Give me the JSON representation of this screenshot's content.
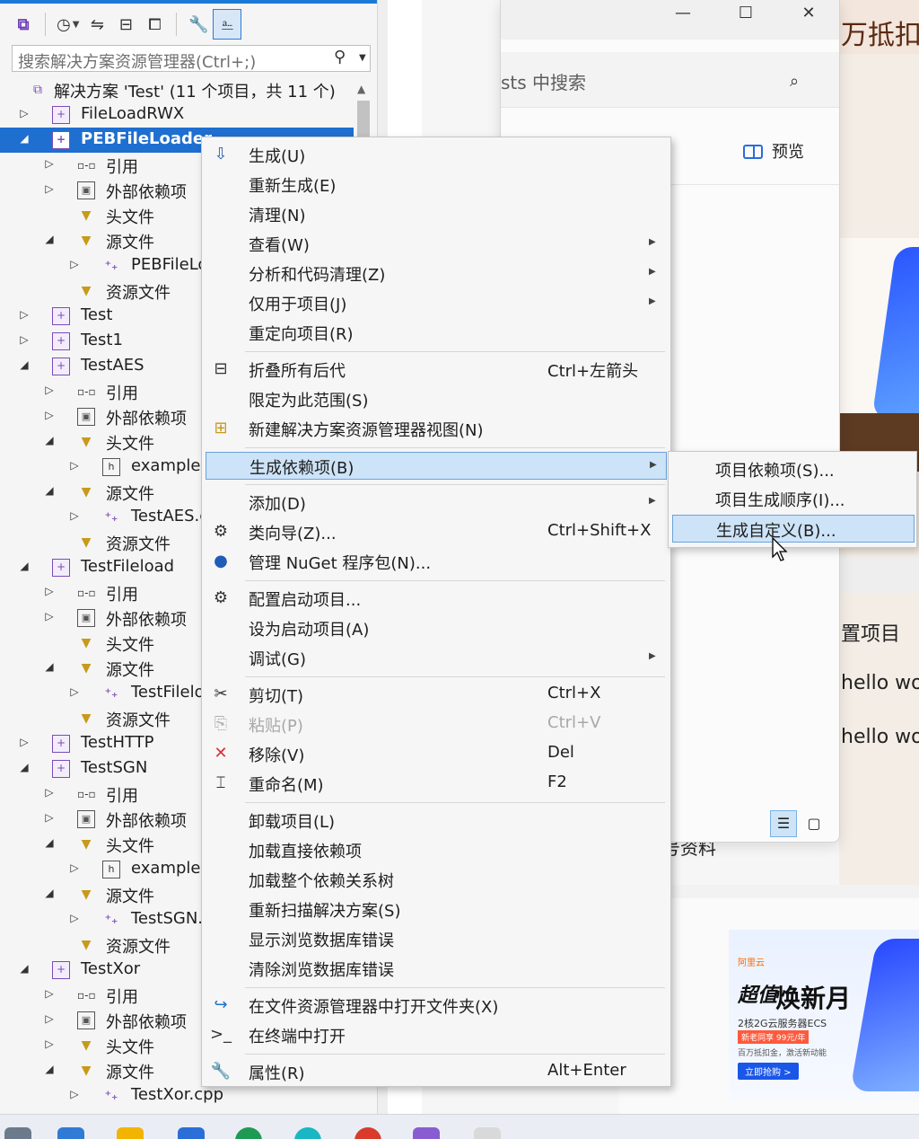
{
  "colors": {
    "selection": "#1e6fcf",
    "menu_highlight": "#cde3f7",
    "menu_highlight_border": "#6ba2db",
    "project_icon": "#7a4db8",
    "folder_icon": "#c79a1b"
  },
  "background": {
    "top_right_text": "万抵扣",
    "window": {
      "search_text": "sts 中搜索",
      "preview_label": "预览"
    },
    "peek": {
      "text1": "置项目",
      "text2": "hello wor",
      "text3": "hello worl",
      "text4": "号资料"
    },
    "ad": {
      "brand": "阿里云",
      "title_small": "超值",
      "title_big": "焕新月",
      "line1": "2核2G云服务器ECS",
      "badge": "新老同享 99元/年",
      "line2": "百万抵扣金，激活新动能",
      "button": "立即抢购 >"
    }
  },
  "solution_explorer": {
    "search_placeholder": "搜索解决方案资源管理器(Ctrl+;)",
    "tree": [
      {
        "depth": 0,
        "expander": "",
        "icon": "solution-icon",
        "label": "解决方案 'Test' (11 个项目，共 11 个)"
      },
      {
        "depth": 0,
        "expander": "collapsed",
        "icon": "project-icon",
        "label": "FileLoadRWX"
      },
      {
        "depth": 0,
        "expander": "expanded",
        "icon": "project-icon",
        "label": "PEBFileLoader",
        "selected": true
      },
      {
        "depth": 1,
        "expander": "collapsed",
        "icon": "reference-icon",
        "label": "引用"
      },
      {
        "depth": 1,
        "expander": "collapsed",
        "icon": "external-deps-icon",
        "label": "外部依赖项"
      },
      {
        "depth": 1,
        "expander": "",
        "icon": "filter-folder-icon",
        "label": "头文件"
      },
      {
        "depth": 1,
        "expander": "expanded",
        "icon": "filter-folder-icon",
        "label": "源文件"
      },
      {
        "depth": 2,
        "expander": "collapsed",
        "icon": "cpp-file-icon",
        "label": "PEBFileLo"
      },
      {
        "depth": 1,
        "expander": "",
        "icon": "filter-folder-icon",
        "label": "资源文件"
      },
      {
        "depth": 0,
        "expander": "collapsed",
        "icon": "project-icon",
        "label": "Test"
      },
      {
        "depth": 0,
        "expander": "collapsed",
        "icon": "project-icon",
        "label": "Test1"
      },
      {
        "depth": 0,
        "expander": "expanded",
        "icon": "project-icon",
        "label": "TestAES"
      },
      {
        "depth": 1,
        "expander": "collapsed",
        "icon": "reference-icon",
        "label": "引用"
      },
      {
        "depth": 1,
        "expander": "collapsed",
        "icon": "external-deps-icon",
        "label": "外部依赖项"
      },
      {
        "depth": 1,
        "expander": "expanded",
        "icon": "filter-folder-icon",
        "label": "头文件"
      },
      {
        "depth": 2,
        "expander": "collapsed",
        "icon": "header-file-icon",
        "label": "example.l"
      },
      {
        "depth": 1,
        "expander": "expanded",
        "icon": "filter-folder-icon",
        "label": "源文件"
      },
      {
        "depth": 2,
        "expander": "collapsed",
        "icon": "cpp-file-icon",
        "label": "TestAES.c"
      },
      {
        "depth": 1,
        "expander": "",
        "icon": "filter-folder-icon",
        "label": "资源文件"
      },
      {
        "depth": 0,
        "expander": "expanded",
        "icon": "project-icon",
        "label": "TestFileload"
      },
      {
        "depth": 1,
        "expander": "collapsed",
        "icon": "reference-icon",
        "label": "引用"
      },
      {
        "depth": 1,
        "expander": "collapsed",
        "icon": "external-deps-icon",
        "label": "外部依赖项"
      },
      {
        "depth": 1,
        "expander": "",
        "icon": "filter-folder-icon",
        "label": "头文件"
      },
      {
        "depth": 1,
        "expander": "expanded",
        "icon": "filter-folder-icon",
        "label": "源文件"
      },
      {
        "depth": 2,
        "expander": "collapsed",
        "icon": "cpp-file-icon",
        "label": "TestFilelo"
      },
      {
        "depth": 1,
        "expander": "",
        "icon": "filter-folder-icon",
        "label": "资源文件"
      },
      {
        "depth": 0,
        "expander": "collapsed",
        "icon": "project-icon",
        "label": "TestHTTP"
      },
      {
        "depth": 0,
        "expander": "expanded",
        "icon": "project-icon",
        "label": "TestSGN"
      },
      {
        "depth": 1,
        "expander": "collapsed",
        "icon": "reference-icon",
        "label": "引用"
      },
      {
        "depth": 1,
        "expander": "collapsed",
        "icon": "external-deps-icon",
        "label": "外部依赖项"
      },
      {
        "depth": 1,
        "expander": "expanded",
        "icon": "filter-folder-icon",
        "label": "头文件"
      },
      {
        "depth": 2,
        "expander": "collapsed",
        "icon": "header-file-icon",
        "label": "example.l"
      },
      {
        "depth": 1,
        "expander": "expanded",
        "icon": "filter-folder-icon",
        "label": "源文件"
      },
      {
        "depth": 2,
        "expander": "collapsed",
        "icon": "cpp-file-icon",
        "label": "TestSGN.c"
      },
      {
        "depth": 1,
        "expander": "",
        "icon": "filter-folder-icon",
        "label": "资源文件"
      },
      {
        "depth": 0,
        "expander": "expanded",
        "icon": "project-icon",
        "label": "TestXor"
      },
      {
        "depth": 1,
        "expander": "collapsed",
        "icon": "reference-icon",
        "label": "引用"
      },
      {
        "depth": 1,
        "expander": "collapsed",
        "icon": "external-deps-icon",
        "label": "外部依赖项"
      },
      {
        "depth": 1,
        "expander": "collapsed",
        "icon": "filter-folder-icon",
        "label": "头文件"
      },
      {
        "depth": 1,
        "expander": "expanded",
        "icon": "filter-folder-icon",
        "label": "源文件"
      },
      {
        "depth": 2,
        "expander": "collapsed",
        "icon": "cpp-file-icon",
        "label": "TestXor.cpp"
      }
    ]
  },
  "context_menu": {
    "items": [
      {
        "type": "item",
        "icon": "build-icon",
        "label": "生成(U)"
      },
      {
        "type": "item",
        "label": "重新生成(E)"
      },
      {
        "type": "item",
        "label": "清理(N)"
      },
      {
        "type": "item",
        "label": "查看(W)",
        "submenu": true
      },
      {
        "type": "item",
        "label": "分析和代码清理(Z)",
        "submenu": true
      },
      {
        "type": "item",
        "label": "仅用于项目(J)",
        "submenu": true
      },
      {
        "type": "item",
        "label": "重定向项目(R)"
      },
      {
        "type": "sep"
      },
      {
        "type": "item",
        "icon": "collapse-all-icon",
        "label": "折叠所有后代",
        "shortcut": "Ctrl+左箭头"
      },
      {
        "type": "item",
        "label": "限定为此范围(S)"
      },
      {
        "type": "item",
        "icon": "new-view-icon",
        "label": "新建解决方案资源管理器视图(N)"
      },
      {
        "type": "sep"
      },
      {
        "type": "item",
        "label": "生成依赖项(B)",
        "submenu": true,
        "highlighted": true
      },
      {
        "type": "sep"
      },
      {
        "type": "item",
        "label": "添加(D)",
        "submenu": true
      },
      {
        "type": "item",
        "icon": "class-wizard-icon",
        "label": "类向导(Z)...",
        "shortcut": "Ctrl+Shift+X"
      },
      {
        "type": "item",
        "icon": "nuget-icon",
        "label": "管理 NuGet 程序包(N)..."
      },
      {
        "type": "sep"
      },
      {
        "type": "item",
        "icon": "gear-icon",
        "label": "配置启动项目..."
      },
      {
        "type": "item",
        "label": "设为启动项目(A)"
      },
      {
        "type": "item",
        "label": "调试(G)",
        "submenu": true
      },
      {
        "type": "sep"
      },
      {
        "type": "item",
        "icon": "cut-icon",
        "label": "剪切(T)",
        "shortcut": "Ctrl+X"
      },
      {
        "type": "item",
        "icon": "paste-icon",
        "label": "粘贴(P)",
        "shortcut": "Ctrl+V",
        "disabled": true
      },
      {
        "type": "item",
        "icon": "remove-icon",
        "label": "移除(V)",
        "shortcut": "Del"
      },
      {
        "type": "item",
        "icon": "rename-icon",
        "label": "重命名(M)",
        "shortcut": "F2"
      },
      {
        "type": "sep"
      },
      {
        "type": "item",
        "label": "卸载项目(L)"
      },
      {
        "type": "item",
        "label": "加载直接依赖项"
      },
      {
        "type": "item",
        "label": "加载整个依赖关系树"
      },
      {
        "type": "item",
        "label": "重新扫描解决方案(S)"
      },
      {
        "type": "item",
        "label": "显示浏览数据库错误"
      },
      {
        "type": "item",
        "label": "清除浏览数据库错误"
      },
      {
        "type": "sep"
      },
      {
        "type": "item",
        "icon": "open-folder-icon",
        "label": "在文件资源管理器中打开文件夹(X)"
      },
      {
        "type": "item",
        "icon": "terminal-icon",
        "label": "在终端中打开"
      },
      {
        "type": "sep"
      },
      {
        "type": "item",
        "icon": "wrench-icon",
        "label": "属性(R)",
        "shortcut": "Alt+Enter"
      }
    ]
  },
  "submenu": {
    "items": [
      {
        "label": "项目依赖项(S)..."
      },
      {
        "label": "项目生成顺序(I)..."
      },
      {
        "label": "生成自定义(B)...",
        "highlighted": true
      }
    ]
  }
}
